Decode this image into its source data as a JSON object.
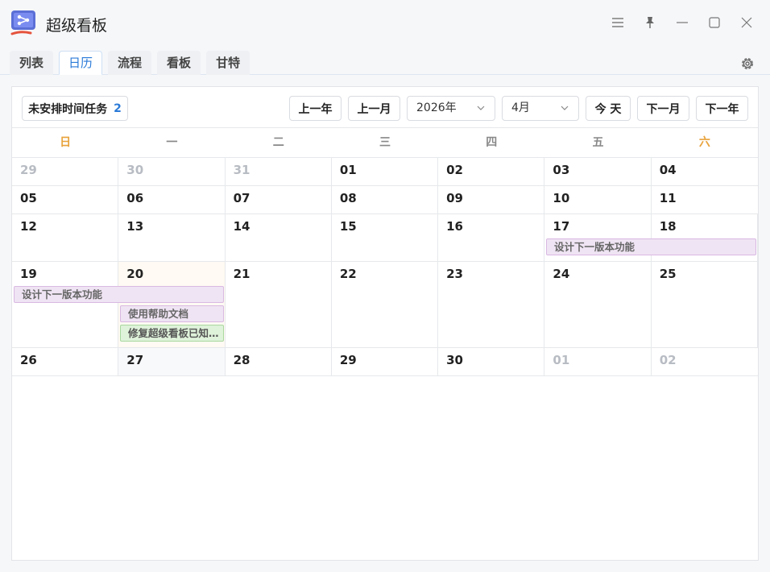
{
  "app": {
    "title": "超级看板",
    "icon": "kanban-app-icon",
    "accent": "#2a7ad8"
  },
  "window_controls": [
    "menu-icon",
    "pin-icon",
    "minimize-icon",
    "maximize-icon",
    "close-icon"
  ],
  "tabs": [
    {
      "label": "列表",
      "active": false
    },
    {
      "label": "日历",
      "active": true
    },
    {
      "label": "流程",
      "active": false
    },
    {
      "label": "看板",
      "active": false
    },
    {
      "label": "甘特",
      "active": false
    }
  ],
  "toolbar": {
    "unscheduled_label": "未安排时间任务",
    "unscheduled_count": "2",
    "prev_year": "上一年",
    "prev_month": "上一月",
    "year_value": "2026年",
    "month_value": "4月",
    "today": "今 天",
    "next_month": "下一月",
    "next_year": "下一年"
  },
  "weekdays": [
    "日",
    "一",
    "二",
    "三",
    "四",
    "五",
    "六"
  ],
  "weeks": [
    {
      "days": [
        "29",
        "30",
        "31",
        "01",
        "02",
        "03",
        "04"
      ],
      "other": [
        true,
        true,
        true,
        false,
        false,
        false,
        false
      ]
    },
    {
      "days": [
        "05",
        "06",
        "07",
        "08",
        "09",
        "10",
        "11"
      ],
      "other": [
        false,
        false,
        false,
        false,
        false,
        false,
        false
      ]
    },
    {
      "days": [
        "12",
        "13",
        "14",
        "15",
        "16",
        "17",
        "18"
      ],
      "other": [
        false,
        false,
        false,
        false,
        false,
        false,
        false
      ]
    },
    {
      "days": [
        "19",
        "20",
        "21",
        "22",
        "23",
        "24",
        "25"
      ],
      "other": [
        false,
        false,
        false,
        false,
        false,
        false,
        false
      ]
    },
    {
      "days": [
        "26",
        "27",
        "28",
        "29",
        "30",
        "01",
        "02"
      ],
      "other": [
        false,
        false,
        false,
        false,
        false,
        true,
        true
      ]
    }
  ],
  "events": [
    {
      "title": "设计下一版本功能",
      "color": "purple"
    },
    {
      "title": "设计下一版本功能",
      "color": "purple"
    },
    {
      "title": "使用帮助文档",
      "color": "purple"
    },
    {
      "title": "修复超级看板已知问题",
      "color": "green"
    }
  ]
}
